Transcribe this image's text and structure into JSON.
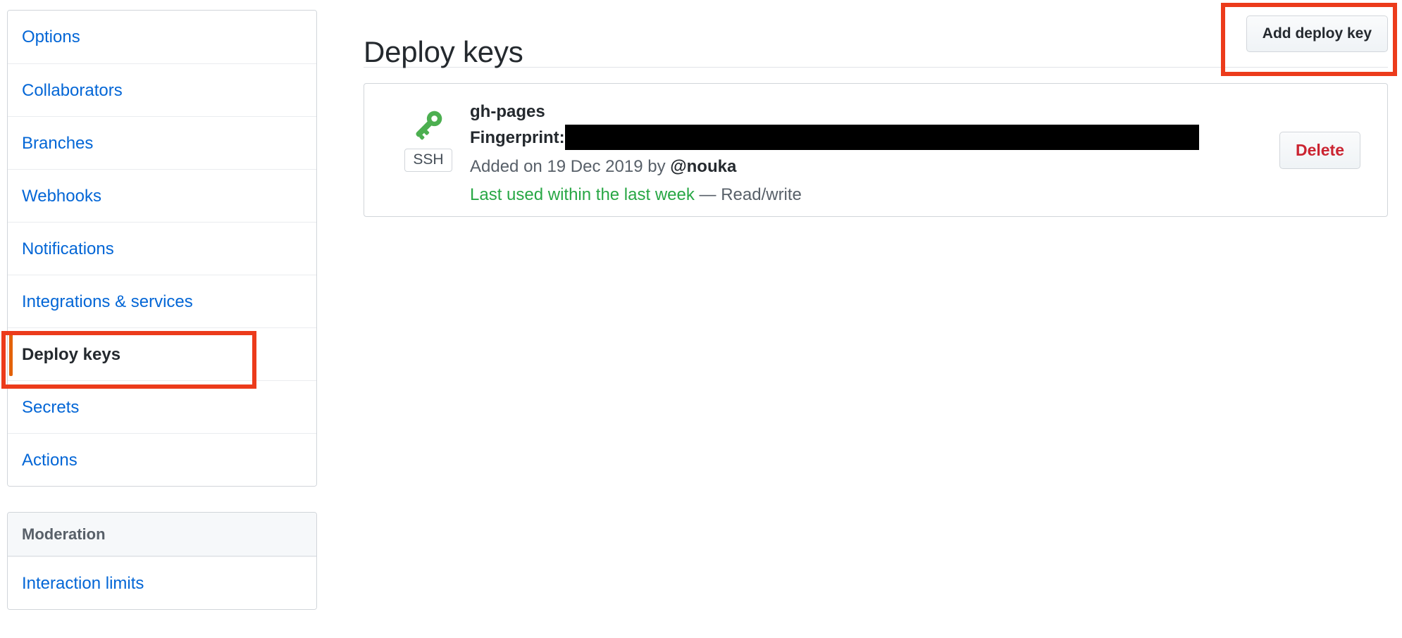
{
  "sidebar": {
    "settings_menu": [
      {
        "label": "Options",
        "selected": false
      },
      {
        "label": "Collaborators",
        "selected": false
      },
      {
        "label": "Branches",
        "selected": false
      },
      {
        "label": "Webhooks",
        "selected": false
      },
      {
        "label": "Notifications",
        "selected": false
      },
      {
        "label": "Integrations & services",
        "selected": false
      },
      {
        "label": "Deploy keys",
        "selected": true
      },
      {
        "label": "Secrets",
        "selected": false
      },
      {
        "label": "Actions",
        "selected": false
      }
    ],
    "moderation": {
      "heading": "Moderation",
      "items": [
        {
          "label": "Interaction limits"
        }
      ]
    }
  },
  "main": {
    "title": "Deploy keys",
    "add_key_label": "Add deploy key",
    "keys": [
      {
        "name": "gh-pages",
        "icon": "key-icon",
        "type_badge": "SSH",
        "fingerprint_label": "Fingerprint:",
        "fingerprint_value": "",
        "fingerprint_redacted": true,
        "added_prefix": "Added on ",
        "added_date": "19 Dec 2019",
        "added_by_prefix": " by ",
        "added_by_user": "@nouka",
        "last_used": "Last used within the last week",
        "separator": " — ",
        "permission": "Read/write",
        "delete_label": "Delete"
      }
    ]
  },
  "annotations": [
    {
      "name": "deploy-keys-sidebar-highlight",
      "color": "#ec3b1b"
    },
    {
      "name": "add-deploy-key-highlight",
      "color": "#ec3b1b"
    }
  ],
  "colors": {
    "link": "#0366d6",
    "text": "#24292e",
    "muted": "#586069",
    "green": "#28a745",
    "danger": "#cb2431",
    "accent_orange": "#e36209",
    "annotation_red": "#ec3b1b",
    "border": "#d1d5da",
    "header_bg": "#f6f8fa"
  }
}
